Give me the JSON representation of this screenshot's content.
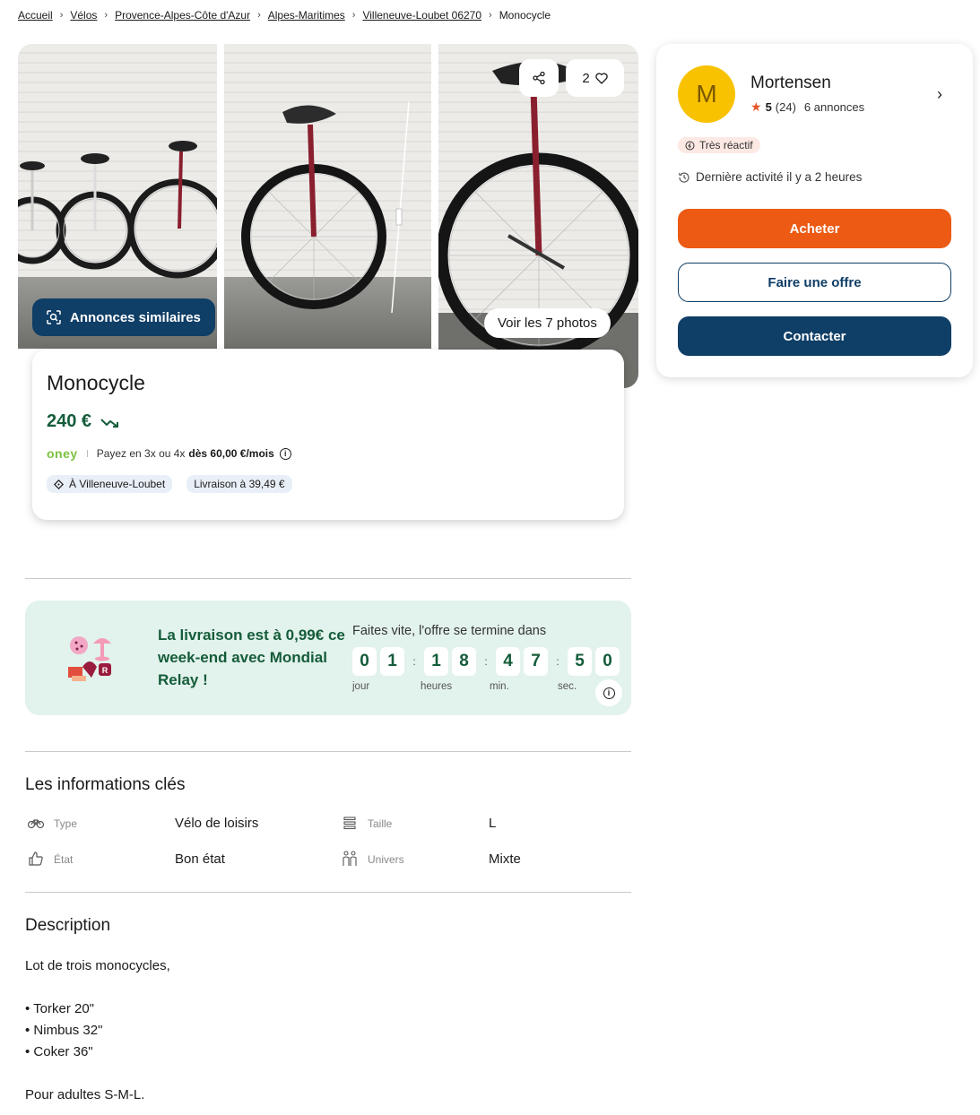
{
  "breadcrumb": [
    {
      "label": "Accueil",
      "link": true
    },
    {
      "label": "Vélos",
      "link": true
    },
    {
      "label": "Provence-Alpes-Côte d'Azur",
      "link": true
    },
    {
      "label": "Alpes-Maritimes",
      "link": true
    },
    {
      "label": "Villeneuve-Loubet 06270",
      "link": true
    },
    {
      "label": "Monocycle",
      "link": false
    }
  ],
  "gallery": {
    "similar_label": "Annonces similaires",
    "photos_label": "Voir les 7 photos",
    "favorites_count": "2"
  },
  "listing": {
    "title": "Monocycle",
    "price": "240 €",
    "oney_brand": "oney",
    "oney_text": "Payez en 3x ou 4x",
    "oney_amount": "dès 60,00 €/mois",
    "location_tag": "À Villeneuve-Loubet",
    "delivery_tag": "Livraison à 39,49 €"
  },
  "seller": {
    "initial": "M",
    "name": "Mortensen",
    "rating": "5",
    "reviews": "(24)",
    "listings": "6 annonces",
    "badge": "Très réactif",
    "last_activity": "Dernière activité il y a 2 heures",
    "buy_label": "Acheter",
    "offer_label": "Faire une offre",
    "contact_label": "Contacter"
  },
  "promo": {
    "text": "La livraison est à 0,99€ ce week-end avec Mondial Relay !",
    "hurry": "Faites vite, l'offre se termine dans",
    "days": [
      "0",
      "1"
    ],
    "hours": [
      "1",
      "8"
    ],
    "minutes": [
      "4",
      "7"
    ],
    "seconds": [
      "5",
      "0"
    ],
    "labels": {
      "days": "jour",
      "hours": "heures",
      "minutes": "min.",
      "seconds": "sec."
    }
  },
  "key_info": {
    "title": "Les informations clés",
    "items": [
      {
        "label": "Type",
        "value": "Vélo de loisirs"
      },
      {
        "label": "Taille",
        "value": "L"
      },
      {
        "label": "État",
        "value": "Bon état"
      },
      {
        "label": "Univers",
        "value": "Mixte"
      }
    ]
  },
  "description": {
    "title": "Description",
    "intro": "Lot de trois monocycles,",
    "bullets": [
      "• Torker  20\"",
      "• Nimbus 32\"",
      "• Coker 36\""
    ],
    "outro": "Pour adultes S-M-L."
  },
  "colors": {
    "brand_blue": "#0f3e66",
    "buy_orange": "#ec5a13",
    "price_green": "#155c3a",
    "promo_bg": "#e2f2ec",
    "avatar_yellow": "#f8c200"
  }
}
